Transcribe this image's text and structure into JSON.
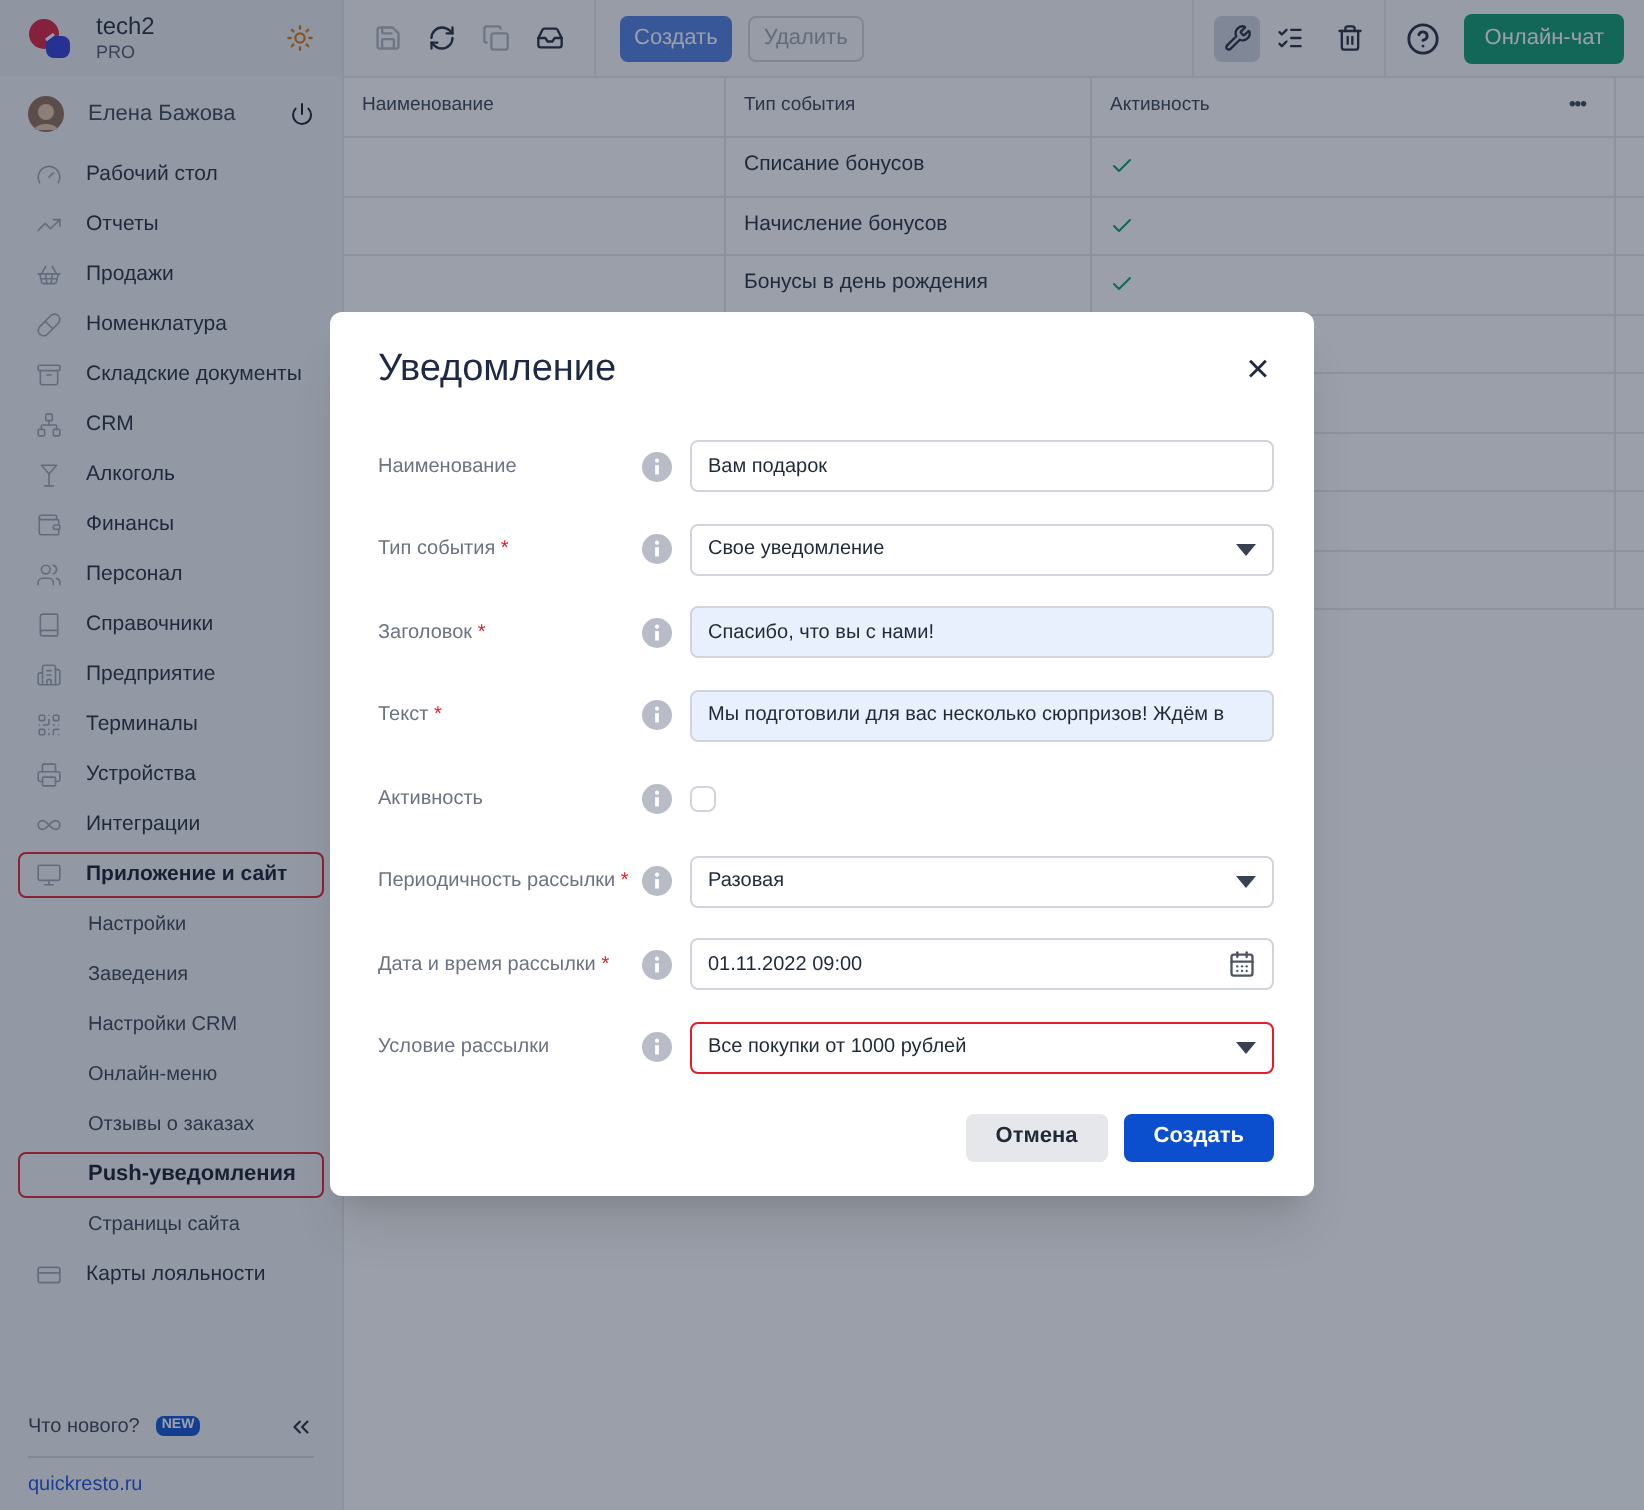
{
  "brand": {
    "name": "tech2",
    "plan": "PRO"
  },
  "user": {
    "name": "Елена Бажова"
  },
  "nav": [
    {
      "label": "Рабочий стол",
      "highlighted": false
    },
    {
      "label": "Отчеты",
      "highlighted": false
    },
    {
      "label": "Продажи",
      "highlighted": false
    },
    {
      "label": "Номенклатура",
      "highlighted": false
    },
    {
      "label": "Складские документы",
      "highlighted": false
    },
    {
      "label": "CRM",
      "highlighted": false
    },
    {
      "label": "Алкоголь",
      "highlighted": false
    },
    {
      "label": "Финансы",
      "highlighted": false
    },
    {
      "label": "Персонал",
      "highlighted": false
    },
    {
      "label": "Справочники",
      "highlighted": false
    },
    {
      "label": "Предприятие",
      "highlighted": false
    },
    {
      "label": "Терминалы",
      "highlighted": false
    },
    {
      "label": "Устройства",
      "highlighted": false
    },
    {
      "label": "Интеграции",
      "highlighted": false
    },
    {
      "label": "Приложение и сайт",
      "highlighted": true,
      "children": [
        {
          "label": "Настройки",
          "selected": false,
          "highlighted": false
        },
        {
          "label": "Заведения",
          "selected": false,
          "highlighted": false
        },
        {
          "label": "Настройки CRM",
          "selected": false,
          "highlighted": false
        },
        {
          "label": "Онлайн-меню",
          "selected": false,
          "highlighted": false
        },
        {
          "label": "Отзывы о заказах",
          "selected": false,
          "highlighted": false
        },
        {
          "label": "Push-уведомления",
          "selected": true,
          "highlighted": true
        },
        {
          "label": "Страницы сайта",
          "selected": false,
          "highlighted": false
        }
      ]
    },
    {
      "label": "Карты лояльности",
      "highlighted": false
    }
  ],
  "sidebar_footer": {
    "whats_new": "Что нового?",
    "badge": "NEW",
    "link": "quickresto.ru"
  },
  "toolbar": {
    "create": "Создать",
    "delete": "Удалить",
    "delete_disabled": true,
    "chat": "Онлайн-чат",
    "settings_selected": true
  },
  "table": {
    "columns": [
      "Наименование",
      "Тип события",
      "Активность"
    ],
    "more": "•••",
    "rows": [
      {
        "name": "",
        "type": "Списание бонусов",
        "active": true
      },
      {
        "name": "",
        "type": "Начисление бонусов",
        "active": true
      },
      {
        "name": "",
        "type": "Бонусы в день рождения",
        "active": true
      }
    ]
  },
  "dialog": {
    "title": "Уведомление",
    "close": "×",
    "required_mark": "*",
    "fields": [
      {
        "kind": "text",
        "label": "Наименование",
        "required": false,
        "value": "Вам подарок",
        "autofilled": false,
        "highlighted": false
      },
      {
        "kind": "select",
        "label": "Тип события",
        "required": true,
        "value": "Свое уведомление",
        "autofilled": false,
        "highlighted": false
      },
      {
        "kind": "text",
        "label": "Заголовок",
        "required": true,
        "value": "Спасибо, что вы с нами!",
        "autofilled": true,
        "highlighted": false
      },
      {
        "kind": "text",
        "label": "Текст",
        "required": true,
        "value": "Мы подготовили для вас несколько сюрпризов! Ждём в",
        "autofilled": true,
        "highlighted": false
      },
      {
        "kind": "checkbox",
        "label": "Активность",
        "required": false,
        "checked": false
      },
      {
        "kind": "select",
        "label": "Периодичность рассылки",
        "required": true,
        "value": "Разовая",
        "autofilled": false,
        "highlighted": false
      },
      {
        "kind": "date",
        "label": "Дата и время рассылки",
        "required": true,
        "value": "01.11.2022 09:00",
        "autofilled": false,
        "highlighted": false
      },
      {
        "kind": "select",
        "label": "Условие рассылки",
        "required": false,
        "value": "Все покупки от 1000 рублей",
        "autofilled": false,
        "highlighted": true
      }
    ],
    "buttons": [
      {
        "label": "Отмена",
        "kind": "secondary"
      },
      {
        "label": "Создать",
        "kind": "primary"
      }
    ]
  }
}
